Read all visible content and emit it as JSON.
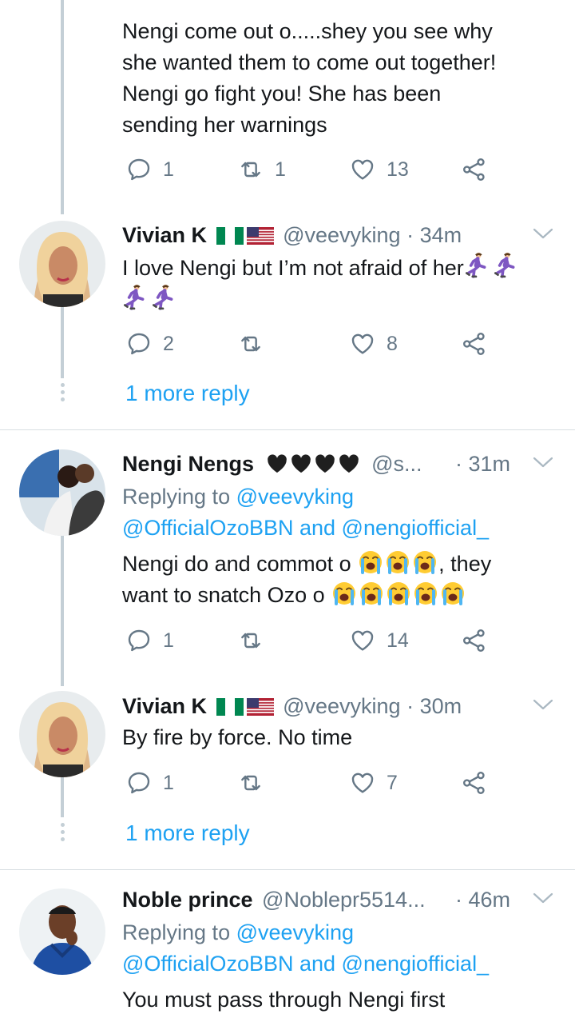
{
  "tweets": [
    {
      "text_lines": [
        "Nengi come out o.....shey you see why",
        "she wanted them to come out together!",
        "Nengi go fight you! She has been",
        "sending her warnings"
      ],
      "replies": "1",
      "retweets": "1",
      "likes": "13"
    },
    {
      "name": "Vivian K",
      "handle": "@veevyking",
      "time": "· 34m",
      "text_line1": "I love Nengi but I’m not afraid of her",
      "replies": "2",
      "retweets": "",
      "likes": "8",
      "more_reply": "1 more reply"
    },
    {
      "name": "Nengi Nengs",
      "handle": "@s...",
      "time": "· 31m",
      "replying_label": "Replying to ",
      "replying_user": "@veevyking",
      "mention1": "@OfficialOzoBBN",
      "and": " and ",
      "mention2": "@nengiofficial_",
      "text_line1": "Nengi do and commot o ",
      "text_line1_end": ", they",
      "text_line2": "want to snatch Ozo o ",
      "replies": "1",
      "retweets": "",
      "likes": "14"
    },
    {
      "name": "Vivian K",
      "handle": "@veevyking",
      "time": "· 30m",
      "text": "By fire by force. No time",
      "replies": "1",
      "retweets": "",
      "likes": "7",
      "more_reply": "1 more reply"
    },
    {
      "name": "Noble prince",
      "handle": "@Noblepr5514...",
      "time": "· 46m",
      "replying_label": "Replying to ",
      "replying_user": "@veevyking",
      "mention1": "@OfficialOzoBBN",
      "and": " and ",
      "mention2": "@nengiofficial_",
      "text": "You must pass through Nengi first"
    }
  ],
  "icons": {
    "reply": "reply-icon",
    "retweet": "retweet-icon",
    "like": "heart-icon",
    "share": "share-icon",
    "caret": "chevron-down-icon",
    "flag1": "nigeria-flag-icon",
    "flag2": "usa-flag-icon",
    "hearts": "black-heart-icon",
    "running": "woman-running-icon",
    "crying": "loudly-crying-face-icon"
  },
  "colors": {
    "link": "#1da1f2",
    "muted": "#657786",
    "thread": "#c4cfd6"
  }
}
